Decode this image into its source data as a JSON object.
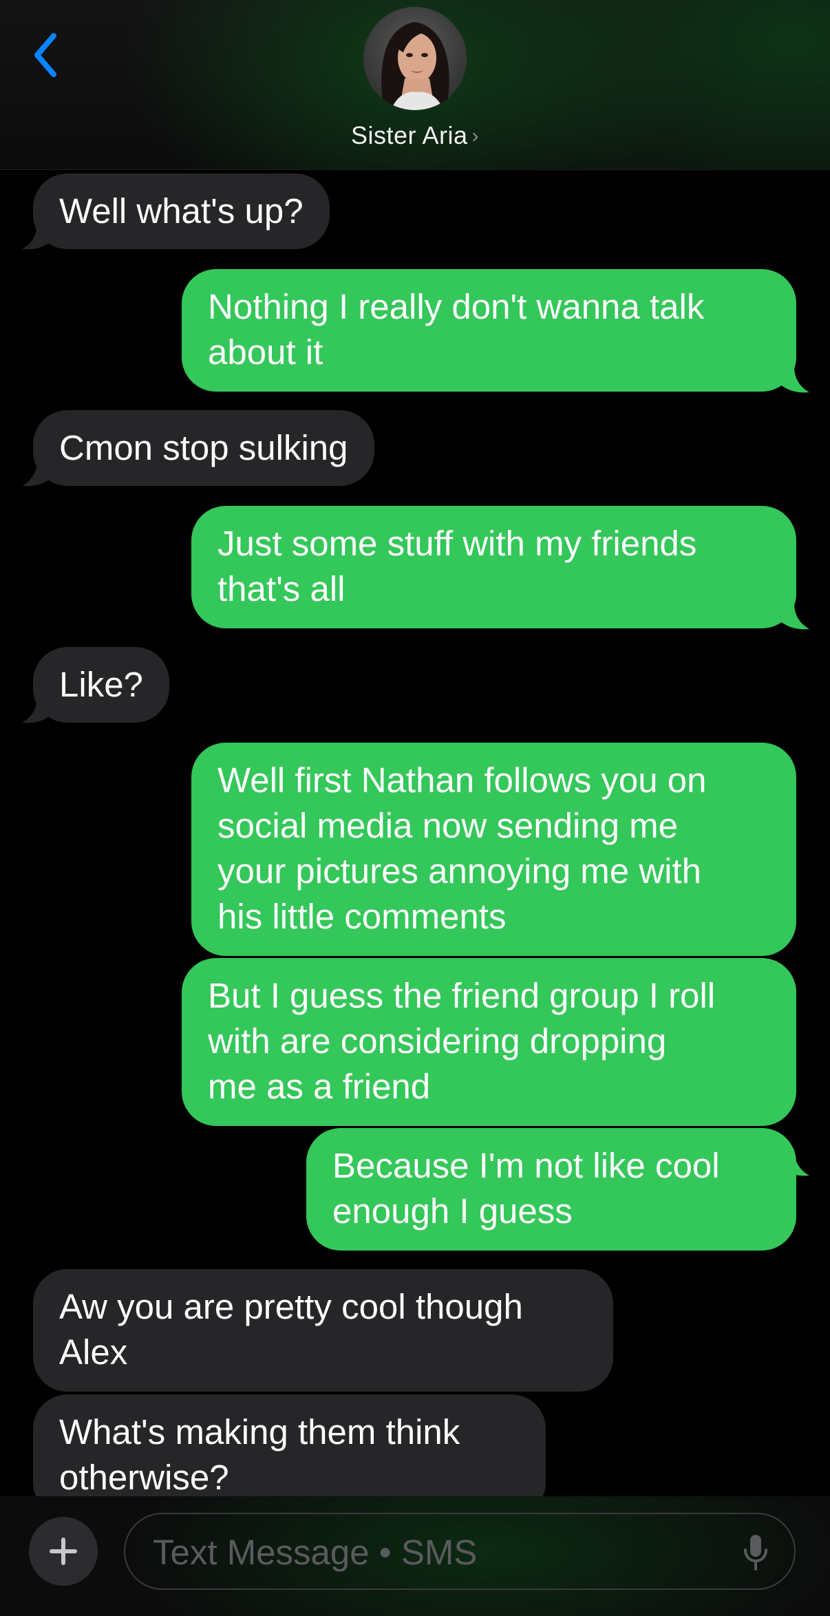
{
  "header": {
    "contact_name": "Sister Aria",
    "chevron": "›",
    "back_icon": "chevron-left-icon",
    "accent_color": "#0a84ff"
  },
  "colors": {
    "incoming_bubble": "#262628",
    "outgoing_bubble": "#34c759"
  },
  "messages": [
    {
      "direction": "in",
      "text": "Well what's up?"
    },
    {
      "direction": "out",
      "text": "Nothing I really don't wanna talk\nabout it"
    },
    {
      "direction": "in",
      "text": "Cmon stop sulking"
    },
    {
      "direction": "out",
      "text": "Just some stuff with my friends\nthat's all"
    },
    {
      "direction": "in",
      "text": "Like?"
    },
    {
      "direction": "out",
      "text": "Well first Nathan follows you on\nsocial media now sending me\nyour pictures annoying me with\nhis little comments"
    },
    {
      "direction": "out",
      "text": "But I guess the friend group I roll\nwith are considering dropping\nme as a friend"
    },
    {
      "direction": "out",
      "text": "Because I'm not like cool\nenough I guess"
    },
    {
      "direction": "in",
      "text": "Aw you are pretty cool though\nAlex"
    },
    {
      "direction": "in",
      "text": "What's making them think\notherwise?"
    }
  ],
  "composer": {
    "placeholder": "Text Message • SMS",
    "plus_icon": "plus-icon",
    "mic_icon": "microphone-icon"
  }
}
